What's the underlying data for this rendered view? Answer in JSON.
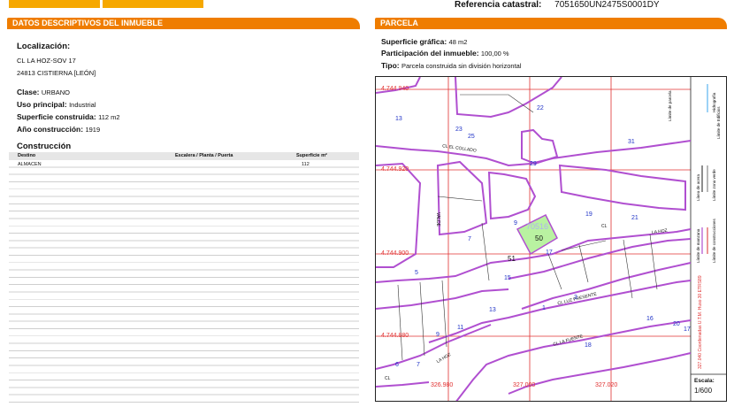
{
  "header": {
    "ref_label": "Referencia catastral:",
    "ref_value": "7051650UN2475S0001DY"
  },
  "left": {
    "section_title": "DATOS DESCRIPTIVOS DEL INMUEBLE",
    "localizacion_label": "Localización:",
    "address_line1": "CL LA HOZ-SOV 17",
    "address_line2": "24813 CISTIERNA [LEÓN]",
    "clase_label": "Clase:",
    "clase_value": "URBANO",
    "uso_label": "Uso principal:",
    "uso_value": "Industrial",
    "superficie_label": "Superficie construida:",
    "superficie_value": "112 m2",
    "anio_label": "Año construcción:",
    "anio_value": "1919",
    "construccion_title": "Construcción",
    "table": {
      "columns": [
        "Destino",
        "Escalera / Planta / Puerta",
        "Superficie m²"
      ],
      "rows": [
        {
          "destino": "ALMACEN",
          "escalera": "",
          "superficie": "112"
        }
      ]
    }
  },
  "right": {
    "section_title": "PARCELA",
    "superficie_label": "Superficie gráfica:",
    "superficie_value": "48 m2",
    "participacion_label": "Participación del inmueble:",
    "participacion_value": "100,00 %",
    "tipo_label": "Tipo:",
    "tipo_value": "Parcela construida sin división horizontal",
    "map": {
      "coord_y": [
        "4.744.940",
        "4.744.920",
        "4.744.900",
        "4.744.880"
      ],
      "coord_x": [
        "326.980",
        "327.000",
        "327.020"
      ],
      "parcel_ref": "70516",
      "parcel_number": "50",
      "block_number": "51",
      "street_names": [
        "CL EL COLLADO",
        "LA HOZ",
        "CL",
        "CL LUZ PRESENTE",
        "CL LA FUENTE",
        "LA HOZ",
        "CL",
        "VALDE"
      ],
      "parcel_numbers": [
        "13",
        "23",
        "25",
        "22",
        "31",
        "29",
        "19",
        "21",
        "9",
        "7",
        "17",
        "15",
        "5",
        "3",
        "1",
        "13",
        "11",
        "9",
        "7",
        "6",
        "18",
        "16",
        "20",
        "17"
      ],
      "escala_label": "Escala:",
      "escala_value": "1/600",
      "legend_top": [
        "Límite de parcela",
        "Hidrografía",
        "Límite de Edificios",
        "Línea de acera",
        "Límite zona verde"
      ],
      "legend_bottom": [
        "Límite de manzana",
        "Límite de construcciones"
      ],
      "coordinate_note": "327.040 Coordenadas U.T.M. Huso 30 ETRS89"
    },
    "colors": {
      "parcel_border": "#b04fd0",
      "parcel_fill": "#b9f2a1",
      "coord_red": "#e03030",
      "label_blue": "#2033c7"
    }
  }
}
